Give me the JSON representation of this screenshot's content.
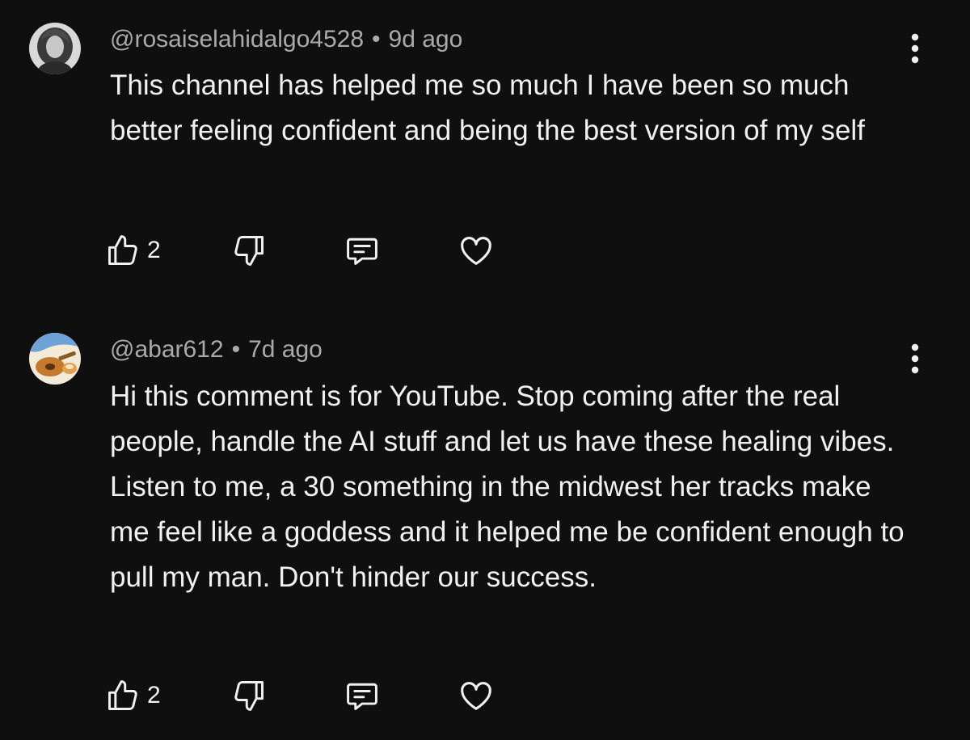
{
  "colors": {
    "background": "#0f0f0f",
    "text_primary": "#f1f1f1",
    "text_secondary": "#aaaaaa"
  },
  "comments": [
    {
      "handle": "@rosaiselahidalgo4528",
      "separator": "•",
      "time": "9d ago",
      "text": "This channel has helped me so much I have been so much better feeling confident and being the best version of my self",
      "like_count": "2",
      "icons": [
        "thumb-up-icon",
        "thumb-down-icon",
        "reply-icon",
        "heart-icon",
        "more-vert-icon"
      ]
    },
    {
      "handle": "@abar612",
      "separator": "•",
      "time": "7d ago",
      "text": "Hi this comment is for YouTube. Stop coming after the real people, handle the AI stuff and let us have these healing vibes. Listen to me, a 30 something in the midwest her tracks make me feel like a goddess and it helped me be confident enough to pull my man. Don't hinder our success.",
      "like_count": "2",
      "icons": [
        "thumb-up-icon",
        "thumb-down-icon",
        "reply-icon",
        "heart-icon",
        "more-vert-icon"
      ]
    }
  ]
}
